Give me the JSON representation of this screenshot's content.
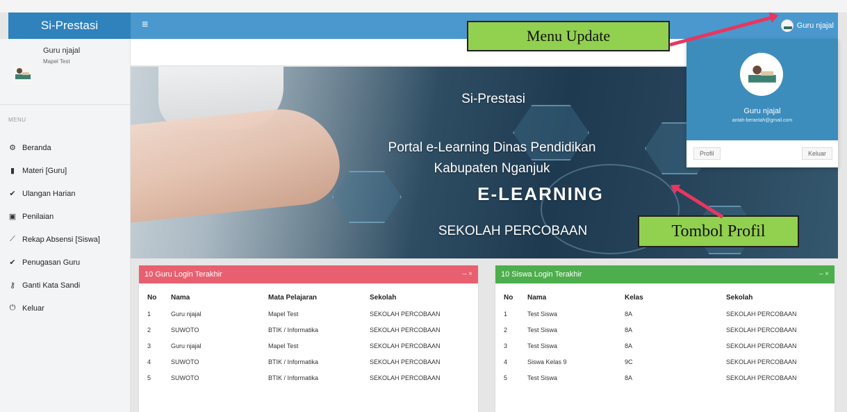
{
  "app": {
    "brand": "Si-Prestasi"
  },
  "header": {
    "menu_icon": "hamburger-icon",
    "user_name": "Guru njajal"
  },
  "sidebar": {
    "user": {
      "name": "Guru njajal",
      "subtitle": "Mapel Test"
    },
    "menu_title": "MENU",
    "items": [
      {
        "label": "Beranda",
        "icon": "dashboard-icon",
        "glyph": "⚙"
      },
      {
        "label": "Materi [Guru]",
        "icon": "folder-icon",
        "glyph": "▮"
      },
      {
        "label": "Ulangan Harian",
        "icon": "check-icon",
        "glyph": "✔"
      },
      {
        "label": "Penilaian",
        "icon": "calculator-icon",
        "glyph": "▣"
      },
      {
        "label": "Rekap Absensi [Siswa]",
        "icon": "line-chart-icon",
        "glyph": "⟋"
      },
      {
        "label": "Penugasan Guru",
        "icon": "check-icon",
        "glyph": "✔"
      },
      {
        "label": "Ganti Kata Sandi",
        "icon": "key-icon",
        "glyph": "⚷"
      },
      {
        "label": "Keluar",
        "icon": "power-icon",
        "glyph": "⏻"
      }
    ]
  },
  "banner": {
    "title": "Si-Prestasi",
    "portal": "Portal e-Learning Dinas Pendidikan",
    "kabupaten": "Kabupaten Nganjuk",
    "elearning": "E-LEARNING",
    "sekolah": "SEKOLAH PERCOBAAN"
  },
  "dropdown": {
    "name": "Guru njajal",
    "email": "antah-berantah@gmail.com",
    "profil_label": "Profil",
    "keluar_label": "Keluar"
  },
  "annotations": {
    "menu_update": "Menu Update",
    "tombol_profil": "Tombol Profil"
  },
  "guru_panel": {
    "title": "10 Guru Login Terakhir",
    "tools": "– ×",
    "columns": [
      "No",
      "Nama",
      "Mata Pelajaran",
      "Sekolah"
    ],
    "rows": [
      [
        "1",
        "Guru njajal",
        "Mapel Test",
        "SEKOLAH PERCOBAAN"
      ],
      [
        "2",
        "SUWOTO",
        "BTIK / Informatika",
        "SEKOLAH PERCOBAAN"
      ],
      [
        "3",
        "Guru njajal",
        "Mapel Test",
        "SEKOLAH PERCOBAAN"
      ],
      [
        "4",
        "SUWOTO",
        "BTIK / Informatika",
        "SEKOLAH PERCOBAAN"
      ],
      [
        "5",
        "SUWOTO",
        "BTIK / Informatika",
        "SEKOLAH PERCOBAAN"
      ]
    ]
  },
  "siswa_panel": {
    "title": "10 Siswa Login Terakhir",
    "tools": "– ×",
    "columns": [
      "No",
      "Nama",
      "Kelas",
      "Sekolah"
    ],
    "rows": [
      [
        "1",
        "Test Siswa",
        "8A",
        "SEKOLAH PERCOBAAN"
      ],
      [
        "2",
        "Test Siswa",
        "8A",
        "SEKOLAH PERCOBAAN"
      ],
      [
        "3",
        "Test Siswa",
        "8A",
        "SEKOLAH PERCOBAAN"
      ],
      [
        "4",
        "Siswa Kelas 9",
        "9C",
        "SEKOLAH PERCOBAAN"
      ],
      [
        "5",
        "Test Siswa",
        "8A",
        "SEKOLAH PERCOBAAN"
      ]
    ]
  },
  "colors": {
    "header": "#4a98cd",
    "logo": "#2f82bc",
    "red_panel": "#e8606f",
    "green_panel": "#4cae4c",
    "annotation": "#92d050",
    "arrow": "#e8365f"
  }
}
